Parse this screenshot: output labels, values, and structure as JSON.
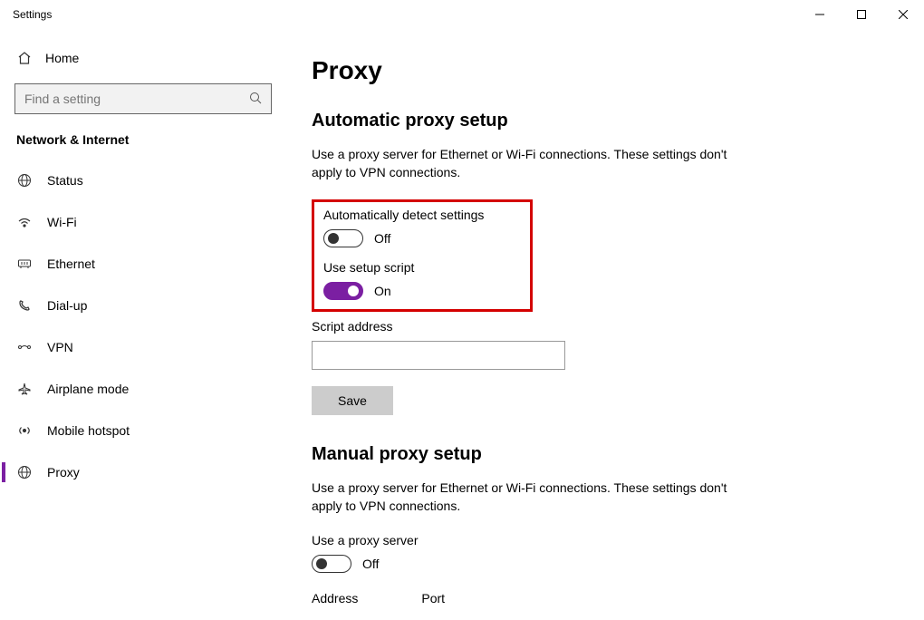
{
  "window": {
    "title": "Settings"
  },
  "sidebar": {
    "home": "Home",
    "search_placeholder": "Find a setting",
    "category": "Network & Internet",
    "items": [
      {
        "label": "Status"
      },
      {
        "label": "Wi-Fi"
      },
      {
        "label": "Ethernet"
      },
      {
        "label": "Dial-up"
      },
      {
        "label": "VPN"
      },
      {
        "label": "Airplane mode"
      },
      {
        "label": "Mobile hotspot"
      },
      {
        "label": "Proxy"
      }
    ]
  },
  "main": {
    "heading": "Proxy",
    "auto": {
      "heading": "Automatic proxy setup",
      "desc": "Use a proxy server for Ethernet or Wi-Fi connections. These settings don't apply to VPN connections.",
      "detect_label": "Automatically detect settings",
      "detect_state": "Off",
      "script_label": "Use setup script",
      "script_state": "On",
      "address_label": "Script address",
      "address_value": "",
      "save_label": "Save"
    },
    "manual": {
      "heading": "Manual proxy setup",
      "desc": "Use a proxy server for Ethernet or Wi-Fi connections. These settings don't apply to VPN connections.",
      "use_label": "Use a proxy server",
      "use_state": "Off",
      "address_label": "Address",
      "port_label": "Port"
    }
  }
}
